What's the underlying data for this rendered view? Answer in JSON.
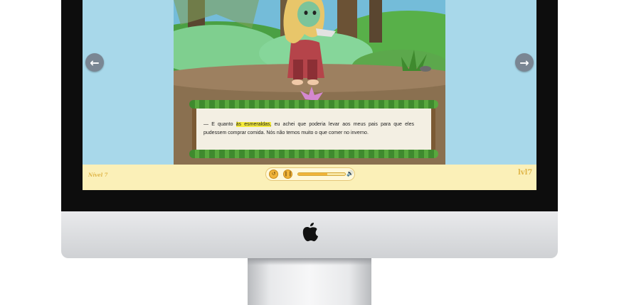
{
  "story": {
    "prefix": "— E quanto ",
    "highlight": "às esmeraldas,",
    "suffix": " eu achei que poderia levar aos meus pais para que eles pudessem comprar comida. Nós não temos muito o que comer no inverno."
  },
  "footer": {
    "level_label": "Nível 7",
    "brand_label": "lvl7"
  },
  "player": {
    "progress": 0.62
  },
  "icons": {
    "prev": "arrow-left-icon",
    "next": "arrow-right-icon",
    "rewind": "rewind-icon",
    "pause": "pause-icon",
    "volume": "volume-icon",
    "logo": "apple-logo-icon"
  },
  "colors": {
    "screen_bg": "#a8d8ea",
    "bar_bg": "#fbf0b8",
    "highlight": "#f4ea3a",
    "button_orange": "#f0b43a"
  }
}
